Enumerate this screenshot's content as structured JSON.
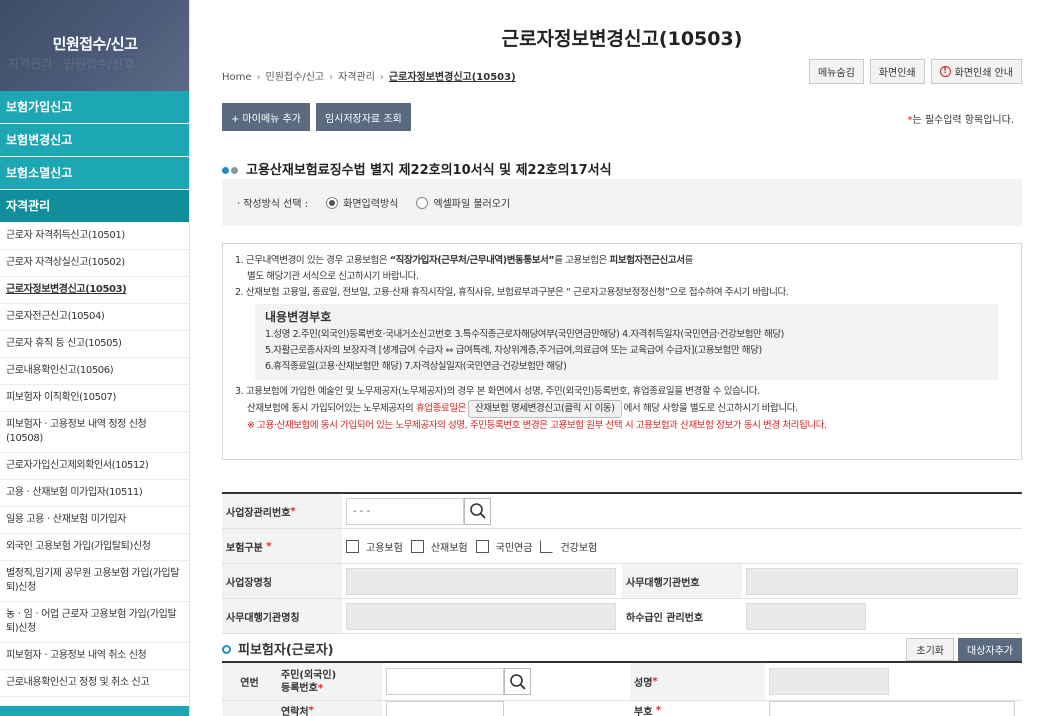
{
  "sidebar": {
    "title": "민원접수/신고",
    "subtitle": "자격관리 · 민원접수/신고",
    "main_items": [
      {
        "label": "보험가입신고"
      },
      {
        "label": "보험변경신고"
      },
      {
        "label": "보험소멸신고"
      },
      {
        "label": "자격관리"
      }
    ],
    "sub_items": [
      {
        "label": "근로자 자격취득신고(10501)"
      },
      {
        "label": "근로자 자격상실신고(10502)"
      },
      {
        "label": "근로자정보변경신고(10503)"
      },
      {
        "label": "근로자전근신고(10504)"
      },
      {
        "label": "근로자 휴직 등 신고(10505)"
      },
      {
        "label": "근로내용확인신고(10506)"
      },
      {
        "label": "피보험자 이직확인(10507)"
      },
      {
        "label": "피보험자ㆍ고용정보 내역 정정 신청(10508)"
      },
      {
        "label": "근로자가입신고제외확인서(10512)"
      },
      {
        "label": "고용ㆍ산재보험 미가입자(10511)"
      },
      {
        "label": "일용 고용ㆍ산재보험 미가입자"
      },
      {
        "label": "외국인 고용보험 가입(가입탈퇴)신청"
      },
      {
        "label": "별정직,임기제 공무원 고용보험 가입(가입탈퇴)신청"
      },
      {
        "label": "농ㆍ임ㆍ어업 근로자 고용보험 가입(가입탈퇴)신청"
      },
      {
        "label": "피보험자ㆍ고용정보 내역 취소 신청"
      },
      {
        "label": "근로내용확인신고 정정 및 취소 신고"
      }
    ]
  },
  "page": {
    "title": "근로자정보변경신고(10503)"
  },
  "breadcrumb": [
    "Home",
    "민원접수/신고",
    "자격관리",
    "근로자정보변경신고(10503)"
  ],
  "top_buttons": {
    "hide_menu": "메뉴숨김",
    "print": "화면인쇄",
    "print_guide": "화면인쇄 안내"
  },
  "actions": {
    "add_my_menu": "+ 마이메뉴 추가",
    "temp_saved": "임시저장자료 조회"
  },
  "required_note": {
    "star": "*",
    "text": "는 필수입력 항목입니다."
  },
  "section_title": "고용산재보험료징수법 별지 제22호의10서식 및 제22호의17서식",
  "method": {
    "label": "ㆍ작성방식 선택 :",
    "options": [
      "화면입력방식",
      "엑셀파일 불러오기"
    ],
    "selected": "화면입력방식"
  },
  "notice": {
    "line1a": "1. 근무내역변경이 있는 경우 고용보험은 ",
    "line1b": "“직장가입자(근무처/근무내역)변동통보서”",
    "line1c": "를 고용보험은 ",
    "line1d": "피보험자전근신고서",
    "line1e": "를",
    "line1_2": "별도 해당기관 서식으로 신고하시기 바랍니다.",
    "line2": "2. 산재보험 고용일, 종료일, 전보일, 고용·산재 휴직시작일, 휴직사유, 보험료부과구분은 “ 근로자고용정보정정신청”으로 접수하여 주시기 바랍니다.",
    "codes_title": "내용변경부호",
    "codes": [
      "1.성명 2.주민(외국인)등록번호·국내거소신고번호 3.특수직종근로자해당여부(국민연금만해당) 4.자격취득일자(국민연금·건강보험만 해당)",
      "5.자활근로종사자의 보장자격 [생계급여 수급자 ⇔ 급여특례, 차상위계층,주거급여,의료급여 또는 교육급여 수급자](고용보험만 해당)",
      "6.휴직종료일(고용·산재보험만 해당) 7.자격상실일자(국민연금·건강보험만 해당)"
    ],
    "line3": "3. 고용보험에 가입한 예술인 및 노무제공자(노무제공자)의 경우 본 화면에서 성명, 주민(외국인)등록번호, 휴업종료일을 변경할 수 있습니다.",
    "line3b_pre": "산재보험에 동시 가입되어있는 노무제공자의 ",
    "line3b_red": "휴업종료일은",
    "line3b_pill": "산재보험 명세변경신고(클릭 시 이동)",
    "line3b_post": "에서 해당 사항을 별도로 신고하시기 바랍니다.",
    "warning": "※ 고용·산재보험에 동시 가입되어 있는 노무제공자의 성명, 주민등록번호 변경은 고용보험 원부 선택 시 고용보험과 산재보험 정보가 동시 변경 처리됩니다."
  },
  "form": {
    "workplace_no_label": "사업장관리번호",
    "workplace_no_value": "- -   -",
    "insurance_type_label": "보험구분",
    "insurance_types": [
      "고용보험",
      "산재보험",
      "국민연금",
      "건강보험"
    ],
    "workplace_name_label": "사업장명칭",
    "agency_no_label": "사무대행기관번호",
    "agency_name_label": "사무대행기관명칭",
    "sub_no_label": "하수급인 관리번호",
    "required_star": "*"
  },
  "worker": {
    "title": "피보험자(근로자)",
    "reset_button": "초기화",
    "add_button": "대상자추가",
    "seq_label": "연번",
    "rrn_label_1": "주민(외국인)",
    "rrn_label_2": "등록번호",
    "name_label": "성명",
    "phone_label": "연락처",
    "code_label": "부호"
  }
}
